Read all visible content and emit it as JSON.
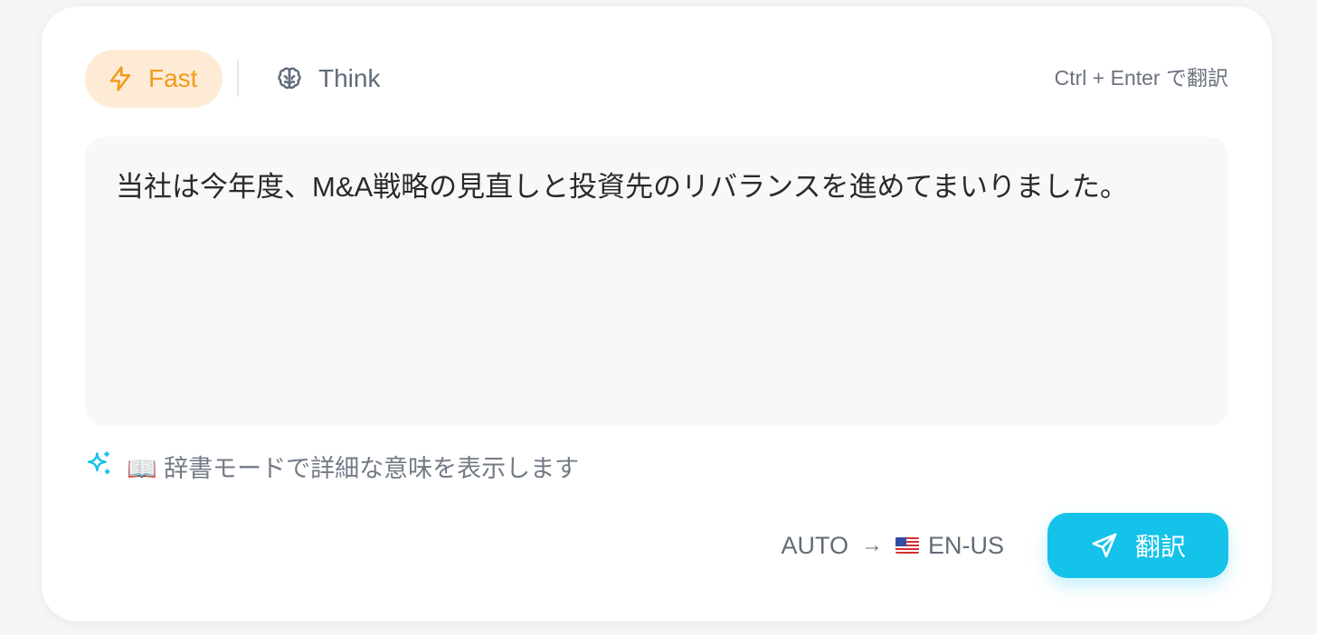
{
  "modes": {
    "fast": {
      "label": "Fast",
      "icon": "lightning-icon",
      "active": true,
      "color": "#f39a1a",
      "background": "#fdebd6"
    },
    "think": {
      "label": "Think",
      "icon": "brain-icon",
      "active": false
    }
  },
  "shortcut_hint": "Ctrl + Enter で翻訳",
  "input": {
    "value": "当社は今年度、M&A戦略の見直しと投資先のリバランスを進めてまいりました。"
  },
  "hint": {
    "icon": "sparkle-icon",
    "text": "📖 辞書モードで詳細な意味を表示します"
  },
  "languages": {
    "source": "AUTO",
    "arrow": "→",
    "target_flag": "us-flag-icon",
    "target": "EN-US"
  },
  "translate_button": {
    "label": "翻訳",
    "icon": "send-icon",
    "color": "#14c2ea"
  }
}
